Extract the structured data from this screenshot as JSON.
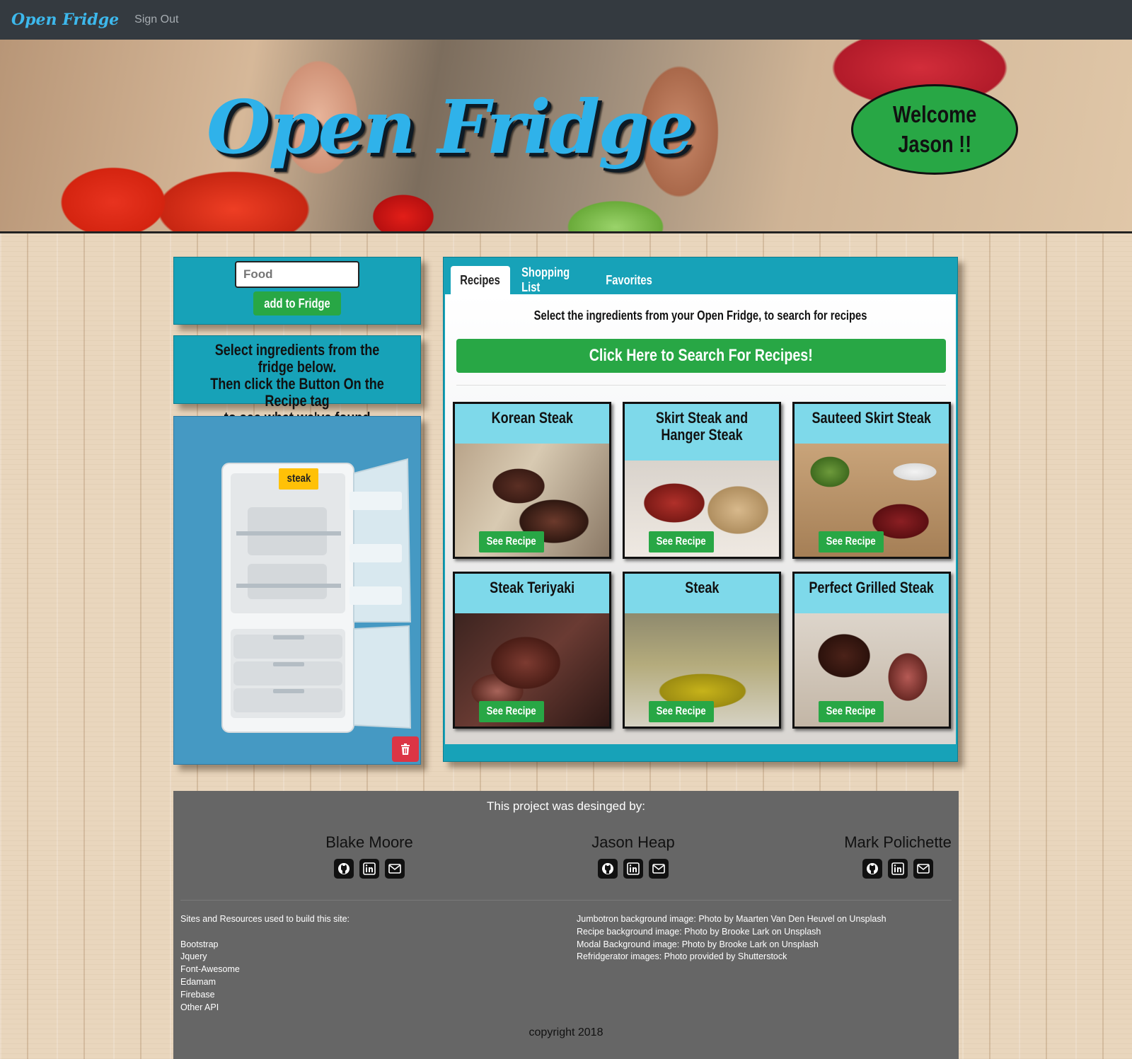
{
  "navbar": {
    "brand": "Open Fridge",
    "sign_out": "Sign Out"
  },
  "jumbotron": {
    "title": "Open Fridge",
    "welcome_line1": "Welcome",
    "welcome_line2": "Jason !!"
  },
  "fridge_form": {
    "input_placeholder": "Food",
    "add_button": "add to Fridge"
  },
  "instructions": {
    "line1": "Select ingredients from the fridge below.",
    "line2": "Then click the Button On the Recipe tag",
    "line3": "to see what we've found"
  },
  "fridge": {
    "items": [
      "steak"
    ],
    "trash_icon": "trash-icon"
  },
  "tabs": [
    {
      "label": "Recipes",
      "active": true
    },
    {
      "label": "Shopping List",
      "active": false
    },
    {
      "label": "Favorites",
      "active": false
    }
  ],
  "recipes_tab": {
    "prompt": "Select the ingredients from your Open Fridge, to search for recipes",
    "search_button": "Click Here to Search For Recipes!",
    "see_recipe_label": "See Recipe",
    "cards": [
      {
        "title": "Korean Steak"
      },
      {
        "title": "Skirt Steak and Hanger Steak"
      },
      {
        "title": "Sauteed Skirt Steak"
      },
      {
        "title": "Steak Teriyaki"
      },
      {
        "title": "Steak"
      },
      {
        "title": "Perfect Grilled Steak"
      }
    ]
  },
  "footer": {
    "intro": "This project was desinged by:",
    "developers": [
      {
        "name": "Blake Moore"
      },
      {
        "name": "Jason Heap"
      },
      {
        "name": "Mark Polichette"
      }
    ],
    "icons": [
      "github-icon",
      "linkedin-icon",
      "email-icon"
    ],
    "resources_heading": "Sites and Resources used to build this site:",
    "resources": [
      "Bootstrap",
      "Jquery",
      "Font-Awesome",
      "Edamam",
      "Firebase",
      "Other API"
    ],
    "credits": [
      "Jumbotron background image: Photo by Maarten Van Den Heuvel on Unsplash",
      "Recipe background image: Photo by Brooke Lark on Unsplash",
      "Modal Background image: Photo by Brooke Lark on Unsplash",
      "Refridgerator images: Photo provided by Shutterstock"
    ],
    "copyright": "copyright 2018"
  }
}
